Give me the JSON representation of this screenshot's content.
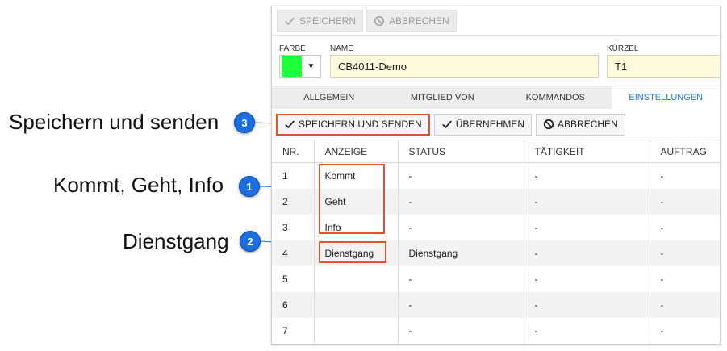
{
  "annotations": [
    {
      "number": "3",
      "text": "Speichern und senden"
    },
    {
      "number": "1",
      "text": "Kommt, Geht, Info"
    },
    {
      "number": "2",
      "text": "Dienstgang"
    }
  ],
  "toolbar": {
    "save_label": "SPEICHERN",
    "cancel_label": "ABBRECHEN"
  },
  "fields": {
    "color_label": "FARBE",
    "color_value": "#21ff3a",
    "name_label": "NAME",
    "name_value": "CB4011-Demo",
    "short_label": "KÜRZEL",
    "short_value": "T1"
  },
  "tabs": [
    {
      "label": "ALLGEMEIN"
    },
    {
      "label": "MITGLIED VON"
    },
    {
      "label": "KOMMANDOS"
    },
    {
      "label": "EINSTELLUNGEN"
    }
  ],
  "actions": {
    "save_send_label": "SPEICHERN UND SENDEN",
    "apply_label": "ÜBERNEHMEN",
    "cancel_label": "ABBRECHEN"
  },
  "table": {
    "headers": [
      "NR.",
      "ANZEIGE",
      "STATUS",
      "TÄTIGKEIT",
      "AUFTRAG"
    ],
    "rows": [
      [
        "1",
        "Kommt",
        "-",
        "-",
        "-"
      ],
      [
        "2",
        "Geht",
        "-",
        "-",
        "-"
      ],
      [
        "3",
        "Info",
        "-",
        "-",
        "-"
      ],
      [
        "4",
        "Dienstgang",
        "Dienstgang",
        "-",
        "-"
      ],
      [
        "5",
        "",
        "-",
        "-",
        "-"
      ],
      [
        "6",
        "",
        "-",
        "-",
        "-"
      ],
      [
        "7",
        "",
        "-",
        "-",
        "-"
      ]
    ]
  },
  "colors": {
    "accent": "#2a7bd0",
    "highlight": "#e0532d",
    "badge": "#1b6fe0"
  }
}
